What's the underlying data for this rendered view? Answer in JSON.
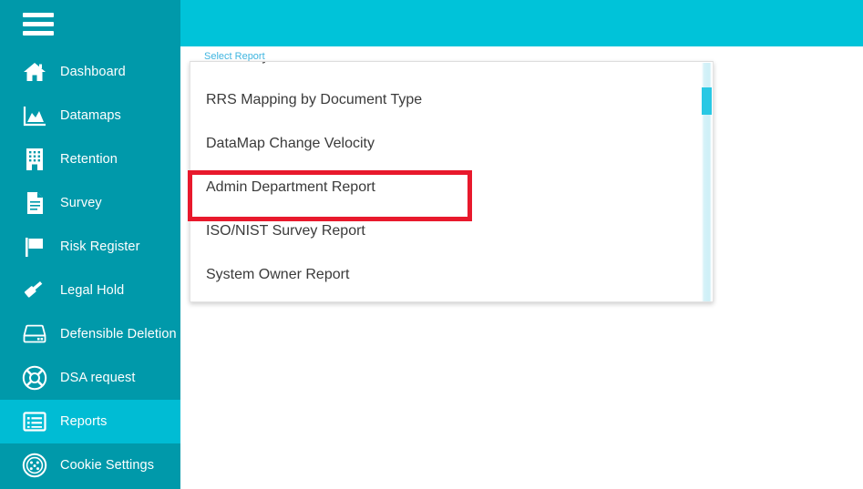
{
  "colors": {
    "sidebar_bg": "#0099aa",
    "sidebar_active": "#00bcd4",
    "header_bg": "#00c3d9",
    "label_accent": "#3fb5e0",
    "highlight_red": "#e8192c",
    "scroll_thumb": "#29c8e4",
    "option_text": "#3a3a3a"
  },
  "sidebar": {
    "menu_toggle": "hamburger-menu",
    "items": [
      {
        "label": "Dashboard",
        "icon": "home-icon",
        "active": false
      },
      {
        "label": "Datamaps",
        "icon": "area-chart-icon",
        "active": false
      },
      {
        "label": "Retention",
        "icon": "building-icon",
        "active": false
      },
      {
        "label": "Survey",
        "icon": "document-icon",
        "active": false
      },
      {
        "label": "Risk Register",
        "icon": "flag-icon",
        "active": false
      },
      {
        "label": "Legal Hold",
        "icon": "gavel-icon",
        "active": false
      },
      {
        "label": "Defensible Deletion",
        "icon": "server-drive-icon",
        "active": false
      },
      {
        "label": "DSA request",
        "icon": "lifebuoy-icon",
        "active": false
      },
      {
        "label": "Reports",
        "icon": "list-report-icon",
        "active": true
      },
      {
        "label": "Cookie Settings",
        "icon": "cookie-icon",
        "active": false
      }
    ]
  },
  "main": {
    "field_label": "Select Report",
    "dropdown": {
      "options": [
        {
          "label": "GDPR Systems",
          "selected": false,
          "clipped": true
        },
        {
          "label": "RRS Mapping by Document Type",
          "selected": false
        },
        {
          "label": "DataMap Change Velocity",
          "selected": false
        },
        {
          "label": "Admin Department Report",
          "selected": true
        },
        {
          "label": "ISO/NIST Survey Report",
          "selected": false
        },
        {
          "label": "System Owner Report",
          "selected": false
        }
      ],
      "scrollbar": {
        "position": "near-top",
        "orientation": "vertical"
      }
    }
  },
  "annotation": {
    "highlight_target": "Admin Department Report",
    "shape": "rectangle-outline"
  }
}
